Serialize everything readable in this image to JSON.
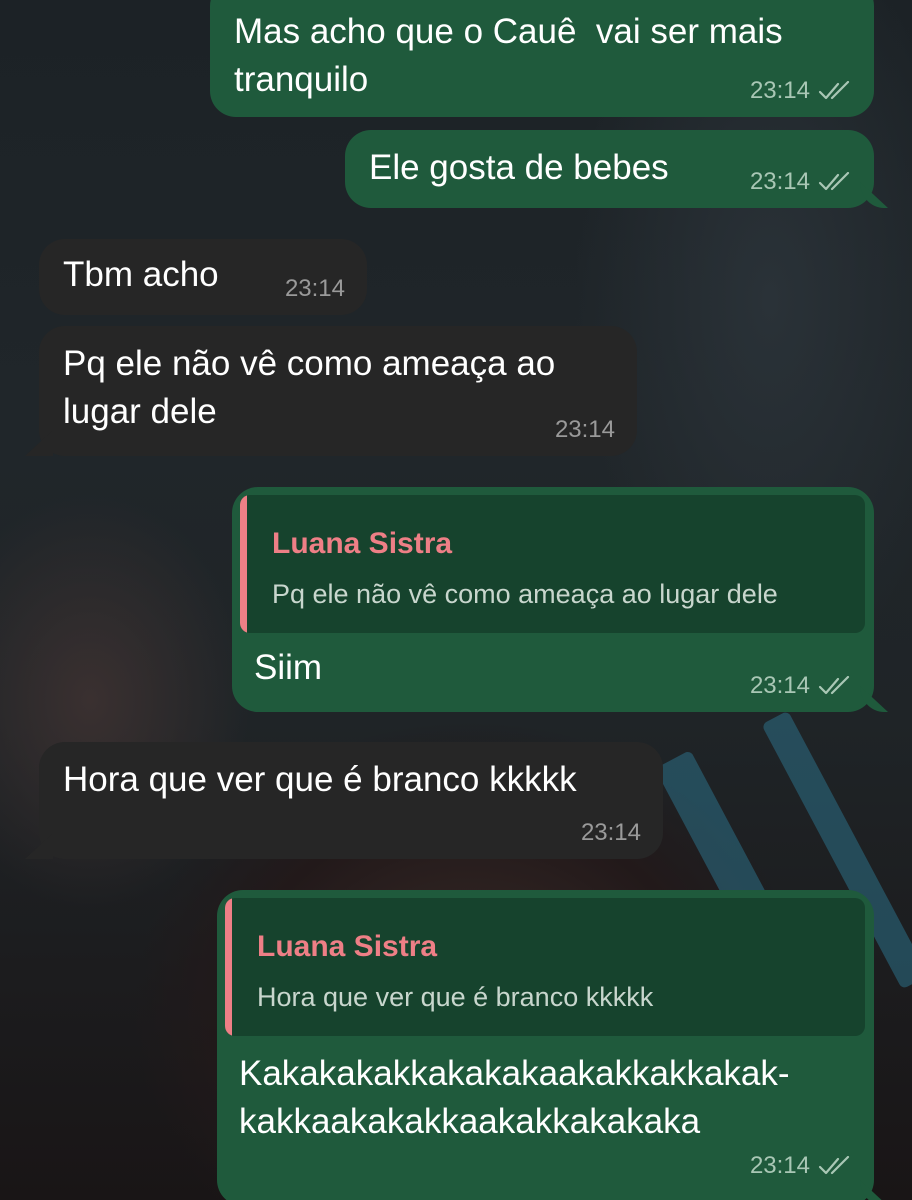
{
  "messages": [
    {
      "direction": "outgoing",
      "text_lines": [
        "Mas acho que o Cauê  vai ser mais",
        "tranquilo"
      ],
      "time": "23:14",
      "status": "read"
    },
    {
      "direction": "outgoing",
      "text_lines": [
        "Ele gosta de bebes"
      ],
      "time": "23:14",
      "status": "read"
    },
    {
      "direction": "incoming",
      "text_lines": [
        "Tbm acho"
      ],
      "time": "23:14"
    },
    {
      "direction": "incoming",
      "text_lines": [
        "Pq ele não vê como ameaça ao",
        "lugar dele"
      ],
      "time": "23:14"
    },
    {
      "direction": "outgoing",
      "quote": {
        "author": "Luana Sistra",
        "text": "Pq ele não vê como ameaça ao lugar dele"
      },
      "text_lines": [
        "Siim"
      ],
      "time": "23:14",
      "status": "read"
    },
    {
      "direction": "incoming",
      "text_lines": [
        "Hora que ver que é branco kkkkk"
      ],
      "time": "23:14"
    },
    {
      "direction": "outgoing",
      "quote": {
        "author": "Luana Sistra",
        "text": "Hora que ver que é branco kkkkk"
      },
      "text_lines": [
        "Kakakakakkakakakaakakkakkakak-",
        "kakkaakakakkaakakkakakaka"
      ],
      "time": "23:14",
      "status": "read"
    }
  ],
  "icons": {
    "read_receipt": "double-check-icon"
  },
  "colors": {
    "outgoing_bubble": "#1f5a3c",
    "incoming_bubble": "#262626",
    "quote_background": "#16432d",
    "quote_accent": "#ee7f86"
  }
}
